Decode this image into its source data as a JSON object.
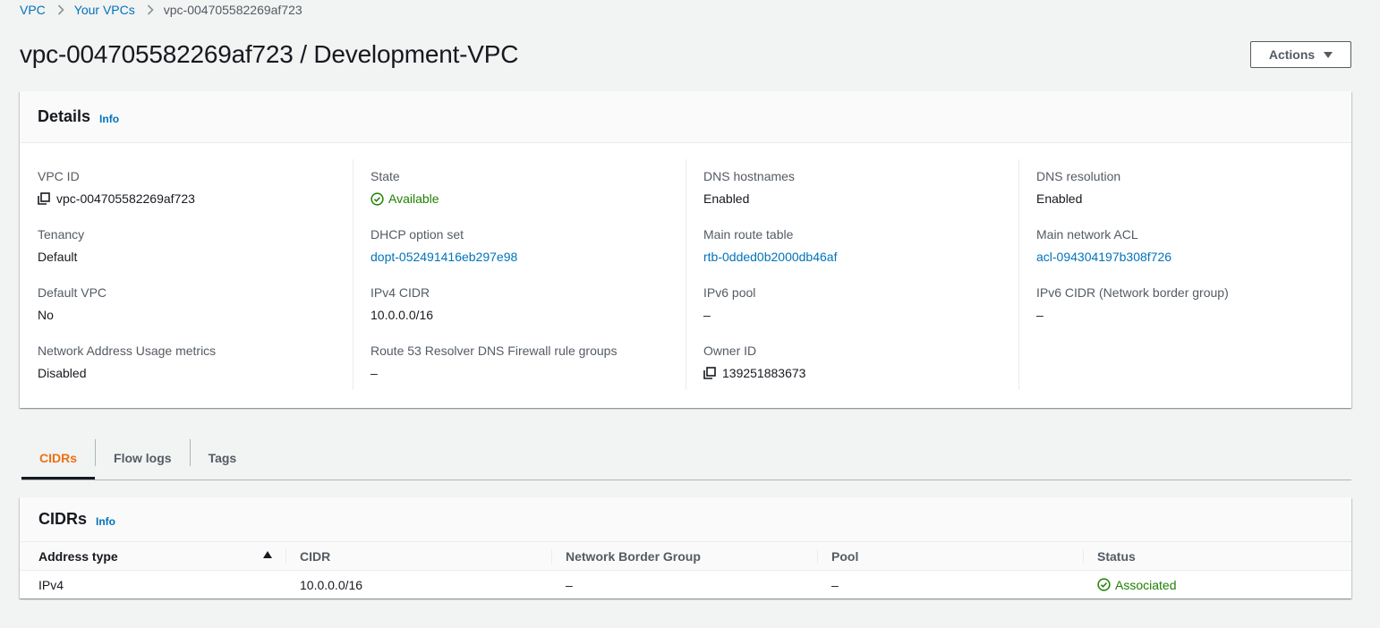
{
  "breadcrumb": {
    "items": [
      "VPC",
      "Your VPCs"
    ],
    "current": "vpc-004705582269af723"
  },
  "page": {
    "title": "vpc-004705582269af723 / Development-VPC",
    "actions_label": "Actions"
  },
  "details": {
    "title": "Details",
    "info_label": "Info",
    "columns": [
      [
        {
          "label": "VPC ID",
          "value": "vpc-004705582269af723",
          "icon": "copy-icon"
        },
        {
          "label": "Tenancy",
          "value": "Default"
        },
        {
          "label": "Default VPC",
          "value": "No"
        },
        {
          "label": "Network Address Usage metrics",
          "value": "Disabled"
        }
      ],
      [
        {
          "label": "State",
          "value": "Available",
          "icon": "check-circle-icon"
        },
        {
          "label": "DHCP option set",
          "value": "dopt-052491416eb297e98"
        },
        {
          "label": "IPv4 CIDR",
          "value": "10.0.0.0/16"
        },
        {
          "label": "Route 53 Resolver DNS Firewall rule groups",
          "value": "–"
        }
      ],
      [
        {
          "label": "DNS hostnames",
          "value": "Enabled"
        },
        {
          "label": "Main route table",
          "value": "rtb-0dded0b2000db46af"
        },
        {
          "label": "IPv6 pool",
          "value": "–"
        },
        {
          "label": "Owner ID",
          "value": "139251883673",
          "icon": "copy-icon"
        }
      ],
      [
        {
          "label": "DNS resolution",
          "value": "Enabled"
        },
        {
          "label": "Main network ACL",
          "value": "acl-094304197b308f726"
        },
        {
          "label": "IPv6 CIDR (Network border group)",
          "value": "–"
        }
      ]
    ]
  },
  "tabs": [
    "CIDRs",
    "Flow logs",
    "Tags"
  ],
  "cidrs": {
    "title": "CIDRs",
    "info_label": "Info",
    "columns": [
      "Address type",
      "CIDR",
      "Network Border Group",
      "Pool",
      "Status"
    ],
    "rows": [
      {
        "address_type": "IPv4",
        "cidr": "10.0.0.0/16",
        "network_border_group": "–",
        "pool": "–",
        "status": "Associated"
      }
    ]
  },
  "colors": {
    "link": "#0073bb",
    "success": "#1d8102",
    "active_tab": "#ec7211"
  }
}
